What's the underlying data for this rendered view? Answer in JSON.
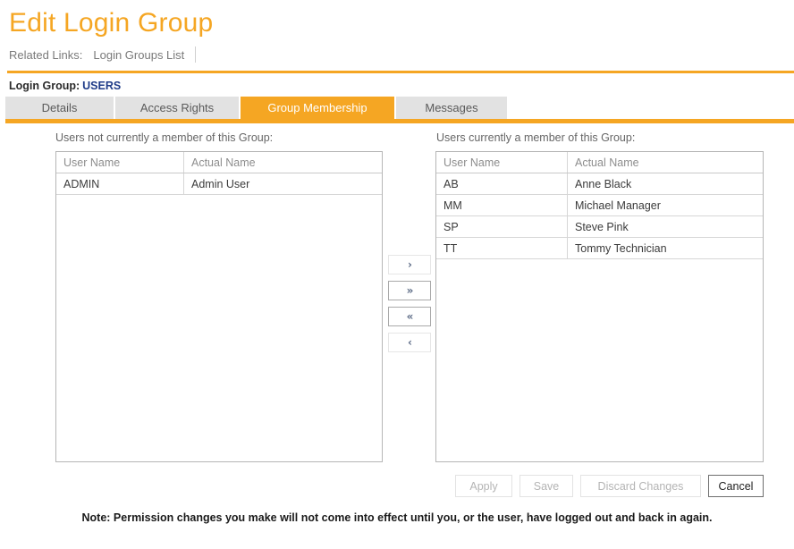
{
  "header": {
    "title": "Edit Login Group",
    "related_links_label": "Related Links:",
    "related_links": [
      {
        "label": "Login Groups List"
      }
    ],
    "group_label": "Login Group:",
    "group_value": "USERS"
  },
  "tabs": [
    {
      "label": "Details",
      "active": false
    },
    {
      "label": "Access Rights",
      "active": false
    },
    {
      "label": "Group Membership",
      "active": true
    },
    {
      "label": "Messages",
      "active": false
    }
  ],
  "panels": {
    "left": {
      "label": "Users not currently a member of this Group:",
      "columns": [
        "User Name",
        "Actual Name"
      ],
      "rows": [
        {
          "user_name": "ADMIN",
          "actual_name": "Admin User"
        }
      ]
    },
    "right": {
      "label": "Users currently a member of this Group:",
      "columns": [
        "User Name",
        "Actual Name"
      ],
      "rows": [
        {
          "user_name": "AB",
          "actual_name": "Anne Black"
        },
        {
          "user_name": "MM",
          "actual_name": "Michael Manager"
        },
        {
          "user_name": "SP",
          "actual_name": "Steve Pink"
        },
        {
          "user_name": "TT",
          "actual_name": "Tommy Technician"
        }
      ]
    }
  },
  "transfer_buttons": [
    {
      "glyph": "›",
      "icon": "chevron-right-icon",
      "name": "move-selected-right",
      "enabled": false
    },
    {
      "glyph": "»",
      "icon": "double-chevron-right-icon",
      "name": "move-all-right",
      "enabled": true
    },
    {
      "glyph": "«",
      "icon": "double-chevron-left-icon",
      "name": "move-all-left",
      "enabled": true
    },
    {
      "glyph": "‹",
      "icon": "chevron-left-icon",
      "name": "move-selected-left",
      "enabled": false
    }
  ],
  "actions": [
    {
      "label": "Apply",
      "enabled": false
    },
    {
      "label": "Save",
      "enabled": false
    },
    {
      "label": "Discard Changes",
      "enabled": false
    },
    {
      "label": "Cancel",
      "enabled": true
    }
  ],
  "footer": {
    "note": "Note: Permission changes you make will not come into effect until you, or the user, have logged out and back in again."
  },
  "colors": {
    "accent": "#F5A623",
    "tab_inactive_bg": "#e2e2e2",
    "group_value": "#1F3C88",
    "muted_text": "#8d8d8d"
  }
}
